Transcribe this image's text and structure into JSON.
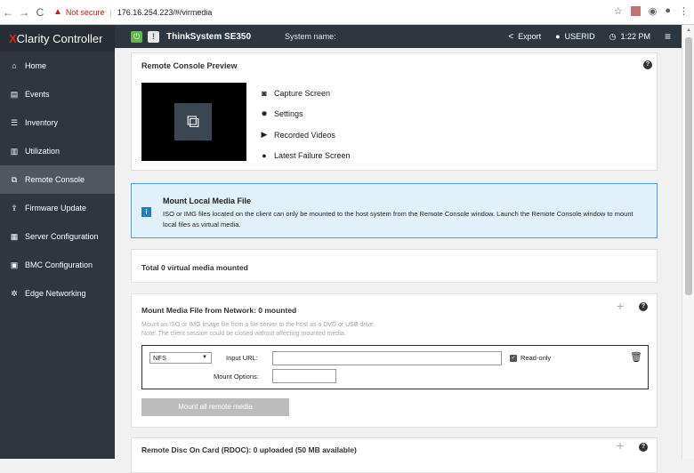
{
  "browser": {
    "nav": [
      "←",
      "→",
      "C"
    ],
    "not_secure": "Not secure",
    "separator": "|",
    "url": "176.16.254.223/#/virmedia"
  },
  "app": {
    "brand_x": "X",
    "brand_rest": "Clarity Controller",
    "system_model": "ThinkSystem SE350",
    "system_name_label": "System name:",
    "export_label": "Export",
    "user_label": "USERID",
    "time": "1:22 PM"
  },
  "sidebar": {
    "items": [
      {
        "label": "Home",
        "icon": "home-icon"
      },
      {
        "label": "Events",
        "icon": "events-icon"
      },
      {
        "label": "Inventory",
        "icon": "list-icon"
      },
      {
        "label": "Utilization",
        "icon": "chart-icon"
      },
      {
        "label": "Remote Console",
        "icon": "launch-icon",
        "active": true
      },
      {
        "label": "Firmware Update",
        "icon": "upload-icon"
      },
      {
        "label": "Server Configuration",
        "icon": "server-icon"
      },
      {
        "label": "BMC Configuration",
        "icon": "bmc-icon"
      },
      {
        "label": "Edge Networking",
        "icon": "network-icon"
      }
    ]
  },
  "remote_console": {
    "title": "Remote Console Preview",
    "links": [
      {
        "label": "Capture Screen",
        "icon": "camera-icon"
      },
      {
        "label": "Settings",
        "icon": "gear-icon"
      },
      {
        "label": "Recorded Videos",
        "icon": "play-icon"
      },
      {
        "label": "Latest Failure Screen",
        "icon": "alert-icon"
      }
    ]
  },
  "local_media": {
    "title": "Mount Local Media File",
    "description": "ISO or IMG files located on the client can only be mounted to the host system from the Remote Console window. Launch the Remote Console window to mount local files as virtual media."
  },
  "total_mounted": "Total 0 virtual media mounted",
  "network_media": {
    "title": "Mount Media File from Network: 0 mounted",
    "desc_line1": "Mount an ISO or IMG image file from a file server to the host as a DVD or USB drive.",
    "desc_line2": "Note: The client session could be closed without affecting mounted media.",
    "protocol": "NFS",
    "input_url_label": "Input URL:",
    "input_url_value": "",
    "mount_options_label": "Mount Options:",
    "mount_options_value": "",
    "readonly_label": "Read-only",
    "readonly_checked": true,
    "mount_button": "Mount all remote media"
  },
  "rdoc": {
    "title": "Remote Disc On Card (RDOC): 0 uploaded (50 MB available)"
  },
  "colors": {
    "sidebar_bg": "#2e363f",
    "active_item": "#4f5861",
    "brand_accent": "#e2231a",
    "power_green": "#5fba46",
    "info_border": "#4aa3e0"
  }
}
